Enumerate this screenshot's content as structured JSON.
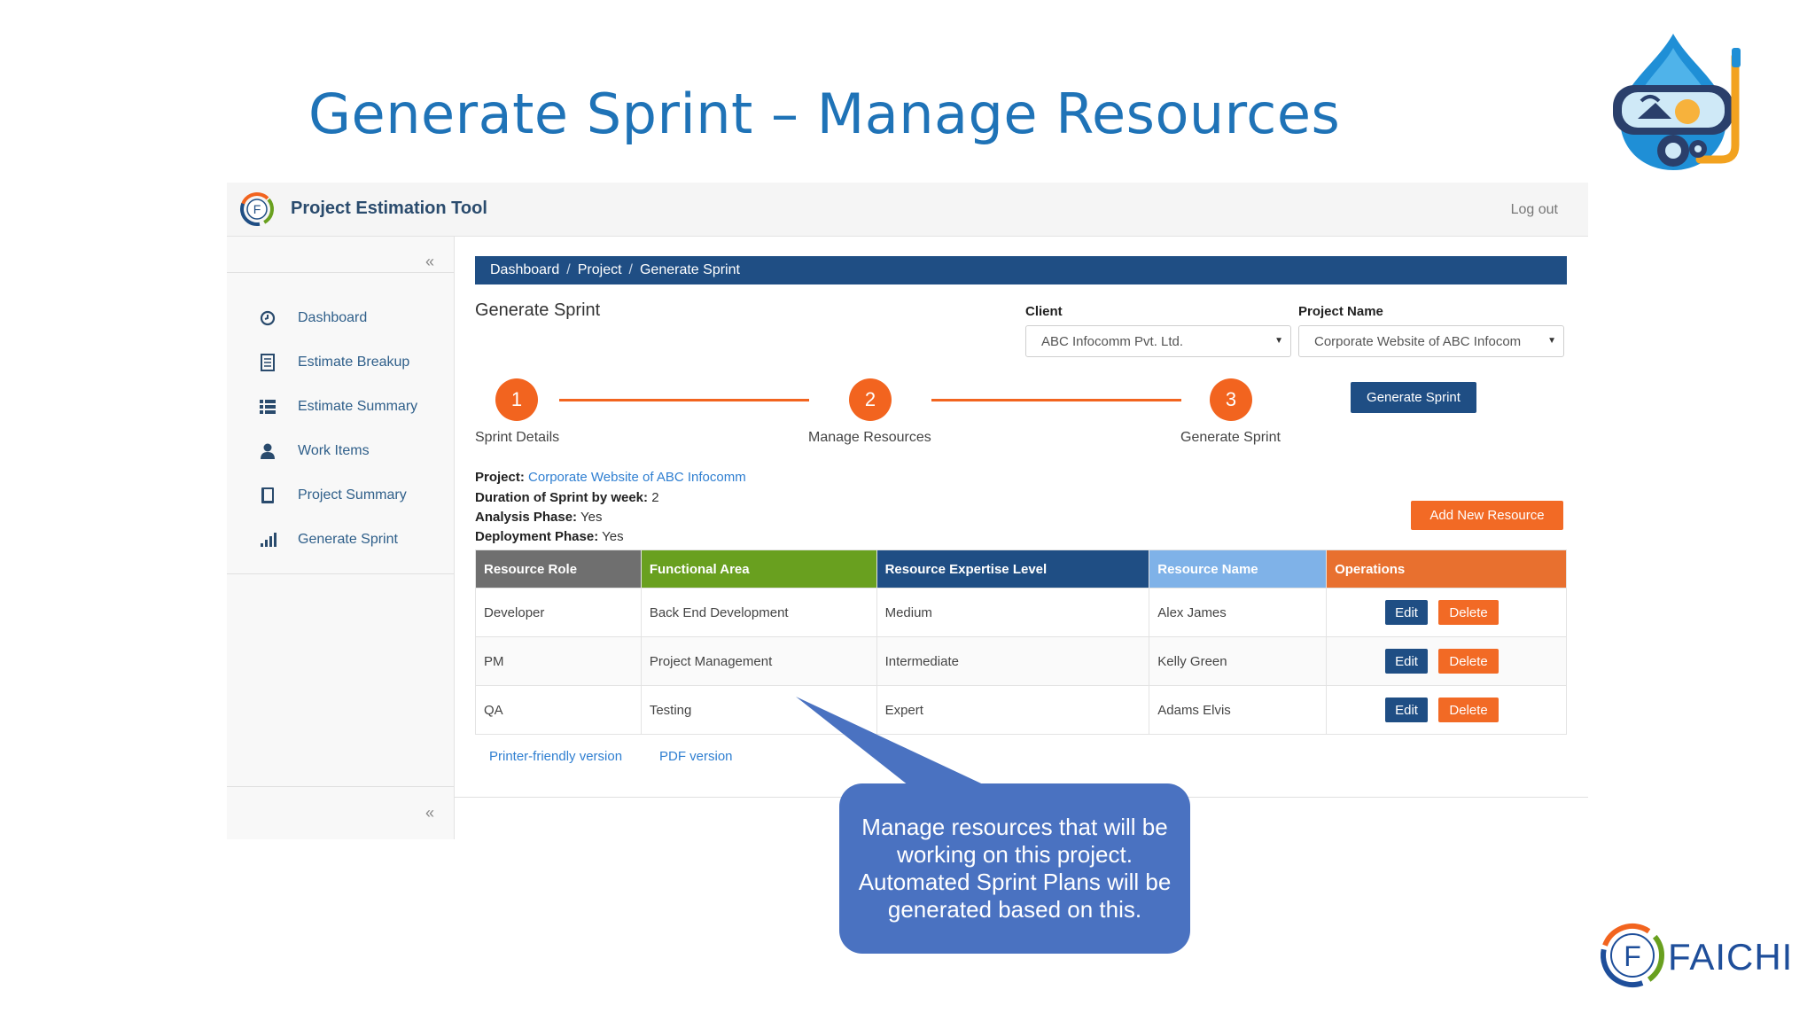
{
  "slide": {
    "title": "Generate Sprint – Manage Resources",
    "callout": "Manage resources that will be working on this project. Automated Sprint Plans will be generated based on this.",
    "brand_name": "FAICHI"
  },
  "app": {
    "name": "Project Estimation Tool",
    "logout_label": "Log out",
    "collapse_label": "«"
  },
  "sidebar": {
    "items": [
      {
        "label": "Dashboard",
        "icon": "clock-icon"
      },
      {
        "label": "Estimate Breakup",
        "icon": "document-icon"
      },
      {
        "label": "Estimate Summary",
        "icon": "list-icon"
      },
      {
        "label": "Work Items",
        "icon": "user-icon"
      },
      {
        "label": "Project Summary",
        "icon": "book-icon"
      },
      {
        "label": "Generate Sprint",
        "icon": "bar-chart-icon"
      }
    ]
  },
  "breadcrumb": [
    "Dashboard",
    "Project",
    "Generate Sprint"
  ],
  "breadcrumb_separator": "/",
  "page": {
    "heading": "Generate Sprint",
    "client_label": "Client",
    "client_value": "ABC Infocomm Pvt. Ltd.",
    "project_label": "Project Name",
    "project_value": "Corporate Website of ABC Infocom",
    "generate_button": "Generate Sprint",
    "add_resource_button": "Add New Resource"
  },
  "steps": [
    {
      "number": "1",
      "label": "Sprint Details"
    },
    {
      "number": "2",
      "label": "Manage Resources"
    },
    {
      "number": "3",
      "label": "Generate Sprint"
    }
  ],
  "project_info": {
    "project_label": "Project:",
    "project_value": "Corporate Website of ABC Infocomm",
    "duration_label": "Duration of Sprint by week:",
    "duration_value": "2",
    "analysis_label": "Analysis Phase:",
    "analysis_value": "Yes",
    "deployment_label": "Deployment Phase:",
    "deployment_value": "Yes"
  },
  "table": {
    "headers": [
      "Resource Role",
      "Functional Area",
      "Resource Expertise Level",
      "Resource Name",
      "Operations"
    ],
    "header_colors": [
      "#6f6f6f",
      "#69a01f",
      "#1f4e84",
      "#7fb2e8",
      "#e8702f"
    ],
    "rows": [
      [
        "Developer",
        "Back End Development",
        "Medium",
        "Alex James"
      ],
      [
        "PM",
        "Project Management",
        "Intermediate",
        "Kelly Green"
      ],
      [
        "QA",
        "Testing",
        "Expert",
        "Adams Elvis"
      ]
    ],
    "edit_label": "Edit",
    "delete_label": "Delete"
  },
  "footer_links": [
    "Printer-friendly version",
    "PDF version"
  ],
  "colors": {
    "title_blue": "#1f73b7",
    "nav_blue": "#1f4e84",
    "accent_orange": "#f26a25",
    "callout_blue": "#4a72c1"
  }
}
